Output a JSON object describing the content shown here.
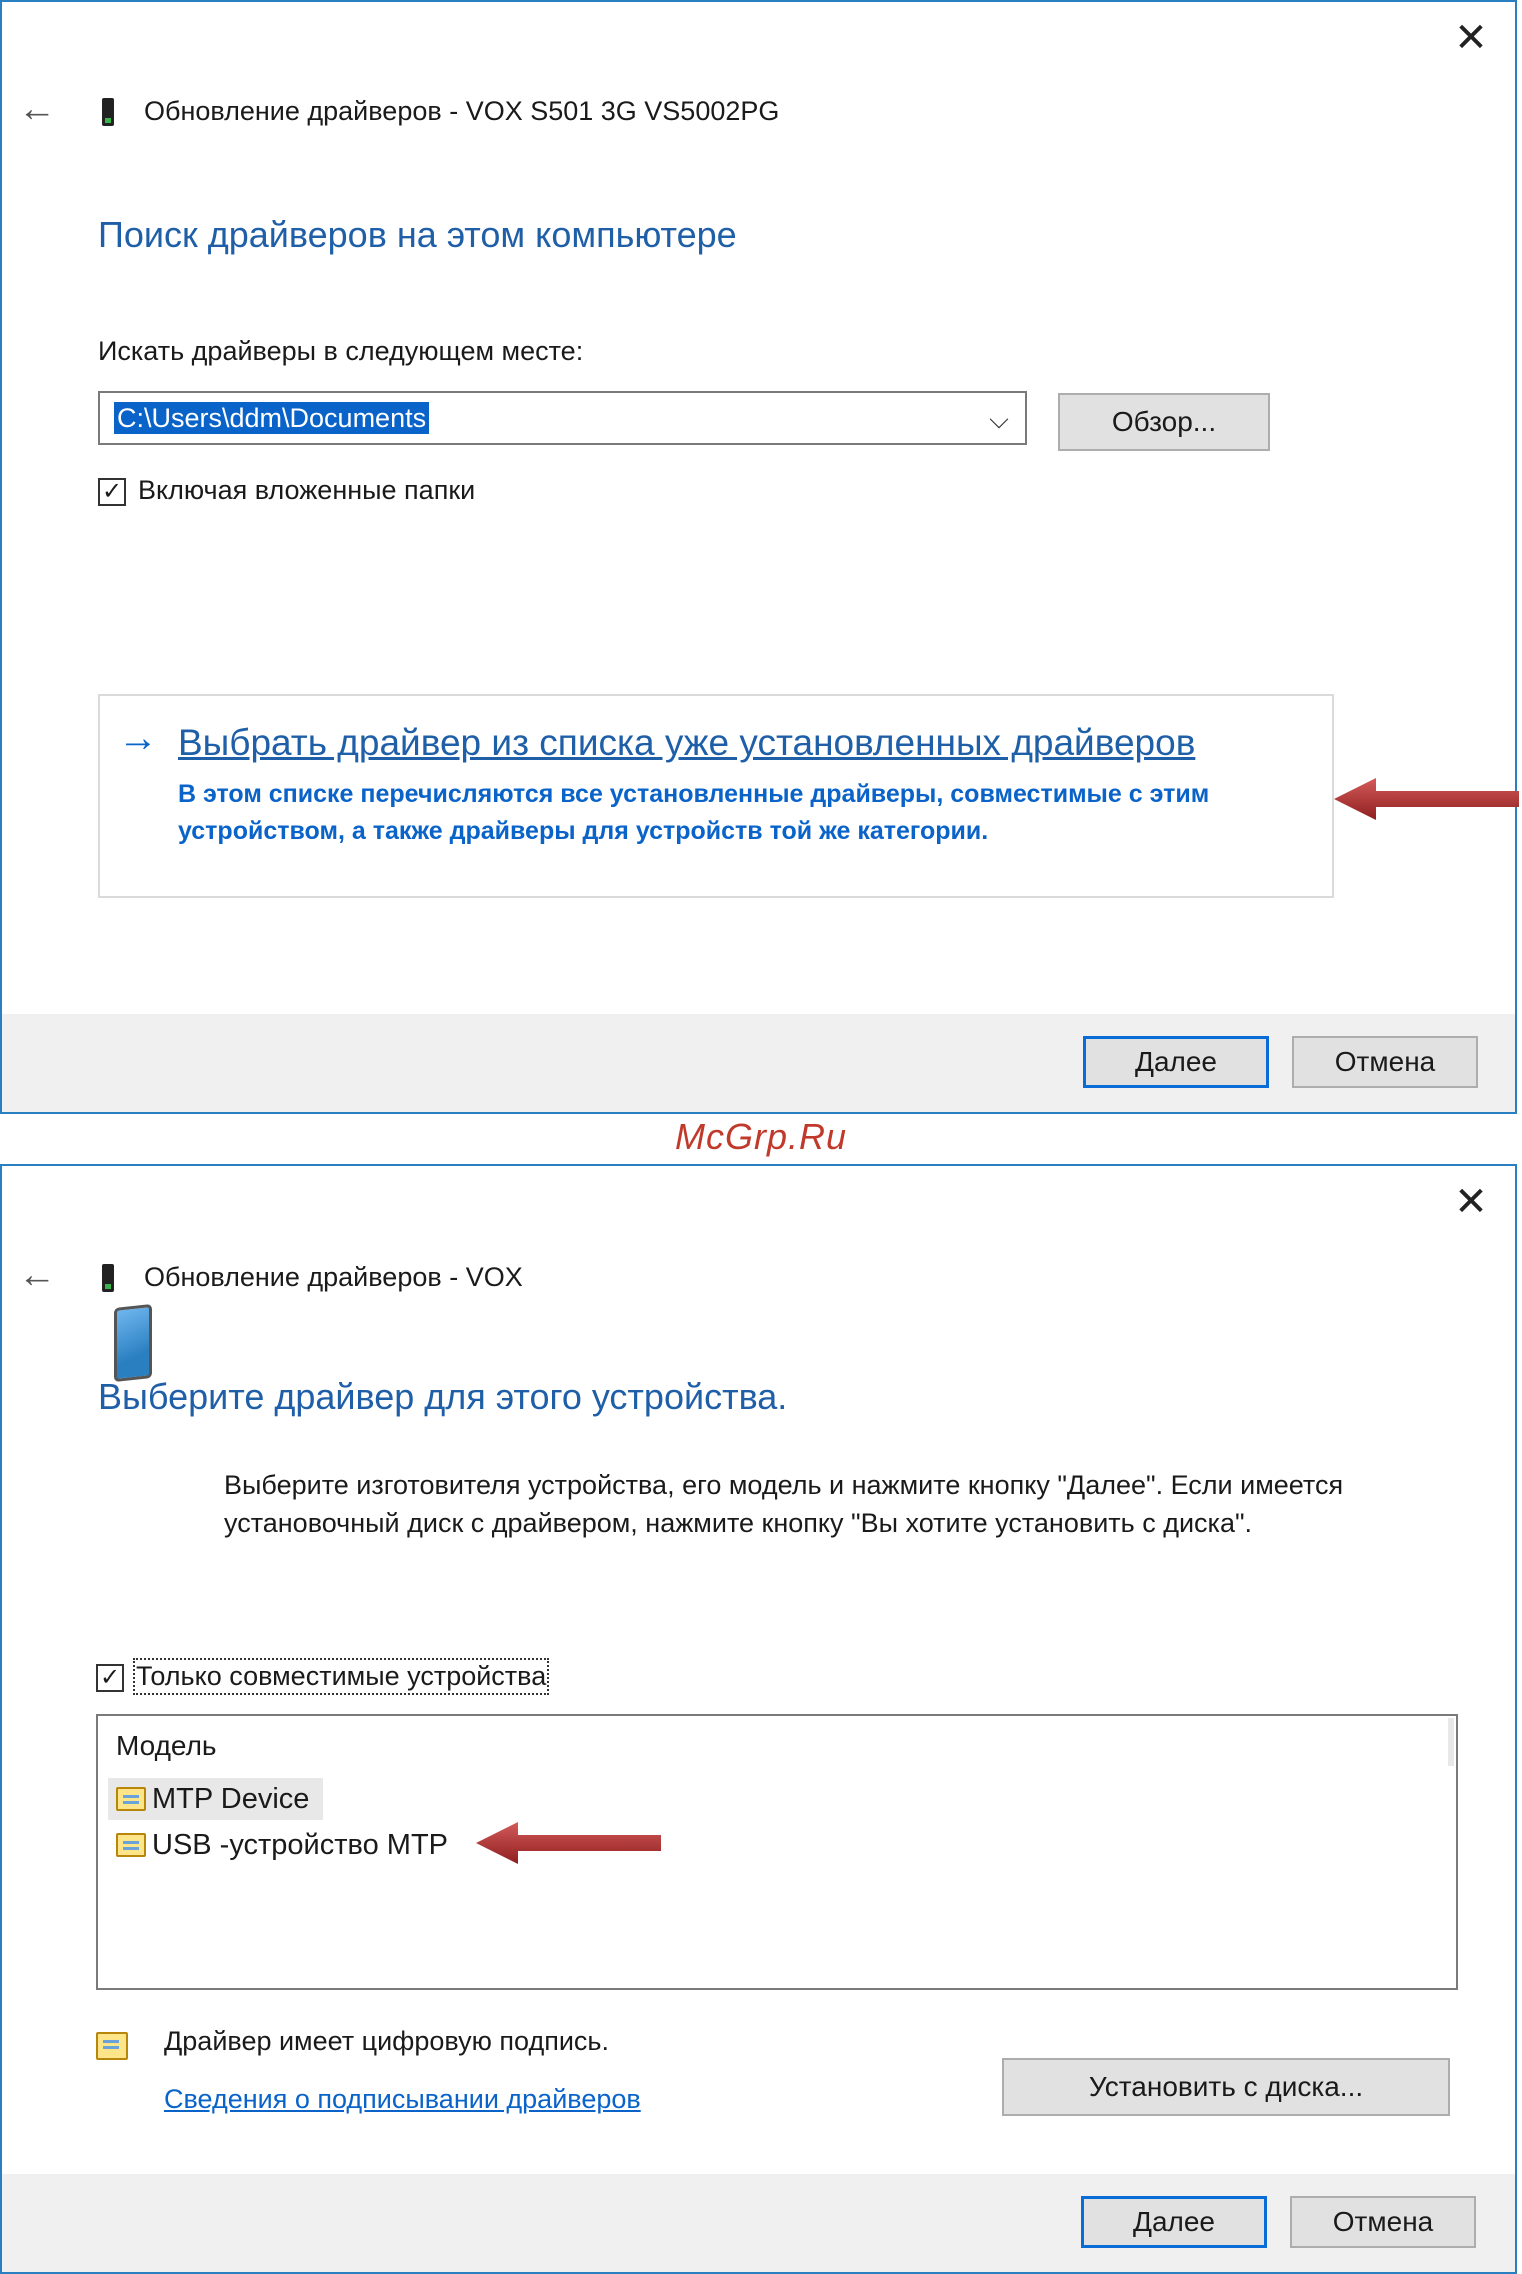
{
  "dialog1": {
    "close_glyph": "✕",
    "window_title": "Обновление драйверов - VOX S501 3G VS5002PG",
    "heading": "Поиск драйверов на этом компьютере",
    "search_label": "Искать драйверы в следующем месте:",
    "path_value": "C:\\Users\\ddm\\Documents",
    "browse_label": "Обзор...",
    "include_subfolders_label": "Включая вложенные папки",
    "include_subfolders_checked": true,
    "option_title": "Выбрать драйвер из списка уже установленных драйверов",
    "option_desc": "В этом списке перечисляются все установленные драйверы, совместимые с этим устройством, а также драйверы для устройств той же категории.",
    "next_label": "Далее",
    "cancel_label": "Отмена"
  },
  "watermark": "McGrp.Ru",
  "dialog2": {
    "close_glyph": "✕",
    "window_title": "Обновление драйверов - VOX",
    "heading": "Выберите драйвер для этого устройства.",
    "description": "Выберите изготовителя устройства, его модель и нажмите кнопку \"Далее\". Если имеется установочный диск с  драйвером, нажмите кнопку \"Вы хотите установить с диска\".",
    "compatible_only_label": "Только совместимые устройства",
    "compatible_only_checked": true,
    "list_header": "Модель",
    "models": [
      "MTP Device",
      "USB -устройство MTP"
    ],
    "signed_text": "Драйвер имеет цифровую подпись.",
    "signing_link": "Сведения о подписывании драйверов",
    "have_disk_label": "Установить с диска...",
    "next_label": "Далее",
    "cancel_label": "Отмена"
  },
  "icons": {
    "back": "left-arrow-icon",
    "close": "close-icon",
    "device": "device-icon",
    "phone": "phone-icon",
    "certificate": "certificate-icon",
    "annotation": "red-arrow-icon"
  },
  "colors": {
    "heading_blue": "#1f5fa8",
    "link_blue": "#0a63c9",
    "selection_blue": "#0a63c9",
    "frame_blue": "#2a7fc0",
    "annotation_red": "#b03030",
    "footer_gray": "#f0f0f0"
  }
}
